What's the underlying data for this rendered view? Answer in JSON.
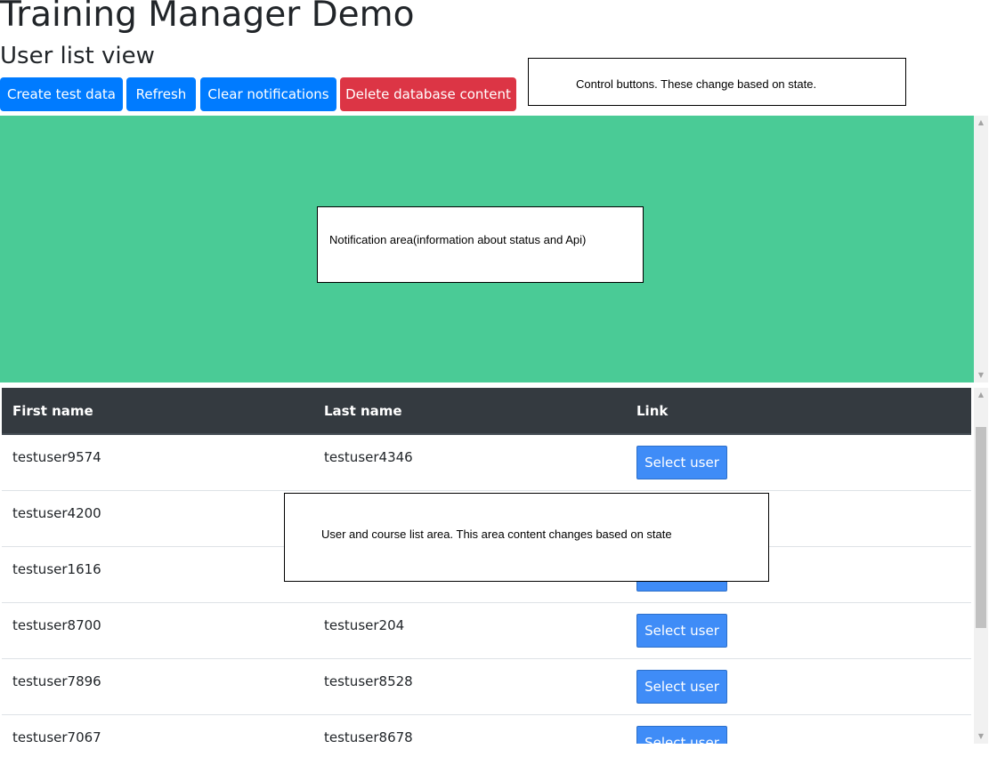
{
  "header": {
    "app_title": "Training Manager Demo",
    "view_title": "User list view"
  },
  "controls": {
    "create_label": "Create test data",
    "refresh_label": "Refresh",
    "clear_label": "Clear notifications",
    "delete_label": "Delete database content"
  },
  "annotations": {
    "controls_note": "Control buttons. These change based on state.",
    "notification_note": "Notification area(information about status and Api)",
    "list_note": "User and course list area. This area content changes based on state"
  },
  "colors": {
    "primary": "#007bff",
    "danger": "#dc3545",
    "notification_bg": "#4acb96",
    "table_header_bg": "#343a40"
  },
  "user_table": {
    "columns": [
      "First name",
      "Last name",
      "Link"
    ],
    "select_label": "Select user",
    "rows": [
      {
        "first": "testuser9574",
        "last": "testuser4346"
      },
      {
        "first": "testuser4200",
        "last": ""
      },
      {
        "first": "testuser1616",
        "last": ""
      },
      {
        "first": "testuser8700",
        "last": "testuser204"
      },
      {
        "first": "testuser7896",
        "last": "testuser8528"
      },
      {
        "first": "testuser7067",
        "last": "testuser8678"
      }
    ]
  }
}
